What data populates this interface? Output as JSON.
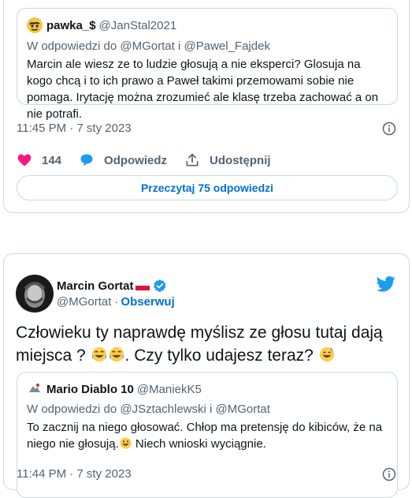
{
  "tweet1": {
    "quote": {
      "name": "pawka_$",
      "handle": "@JanStal2021",
      "reply_prefix": "W odpowiedzi do",
      "reply_to_1": "@MGortat",
      "reply_and": "i",
      "reply_to_2": "@Pawel_Fajdek",
      "text": "Marcin ale wiesz ze to ludzie głosują a nie eksperci? Glosuja na kogo chcą i to ich prawo a Paweł takimi przemowami sobie nie pomaga. Irytację można zrozumieć ale klasę trzeba zachować a on nie potrafi."
    },
    "timestamp": "11:45 PM · 7 sty 2023",
    "likes": "144",
    "reply_label": "Odpowiedz",
    "share_label": "Udostępnij",
    "read_replies": "Przeczytaj 75 odpowiedzi"
  },
  "tweet2": {
    "author_name": "Marcin Gortat",
    "author_handle": "@MGortat",
    "dot": "·",
    "follow_label": "Obserwuj",
    "text_part1": "Człowieku ty naprawdę myślisz ze głosu tutaj dają miejsca ?",
    "text_part2": ". Czy tylko udajesz teraz?",
    "quote": {
      "name": "Mario Diablo 10",
      "handle": "@ManiekK5",
      "reply_prefix": "W odpowiedzi do",
      "reply_to_1": "@JSztachlewski",
      "reply_and": "i",
      "reply_to_2": "@MGortat",
      "text": "To zacznij na niego głosować. Chłop ma pretensję do kibiców, że na niego nie głosują."
    },
    "quote_text_tail": " Niech wnioski wyciągnie.",
    "timestamp": "11:44 PM · 7 sty 2023"
  },
  "colors": {
    "link": "#006fd6",
    "muted": "#536471",
    "like": "#f91880",
    "twitter_blue": "#1d9bf0",
    "border": "#cfd9de"
  }
}
